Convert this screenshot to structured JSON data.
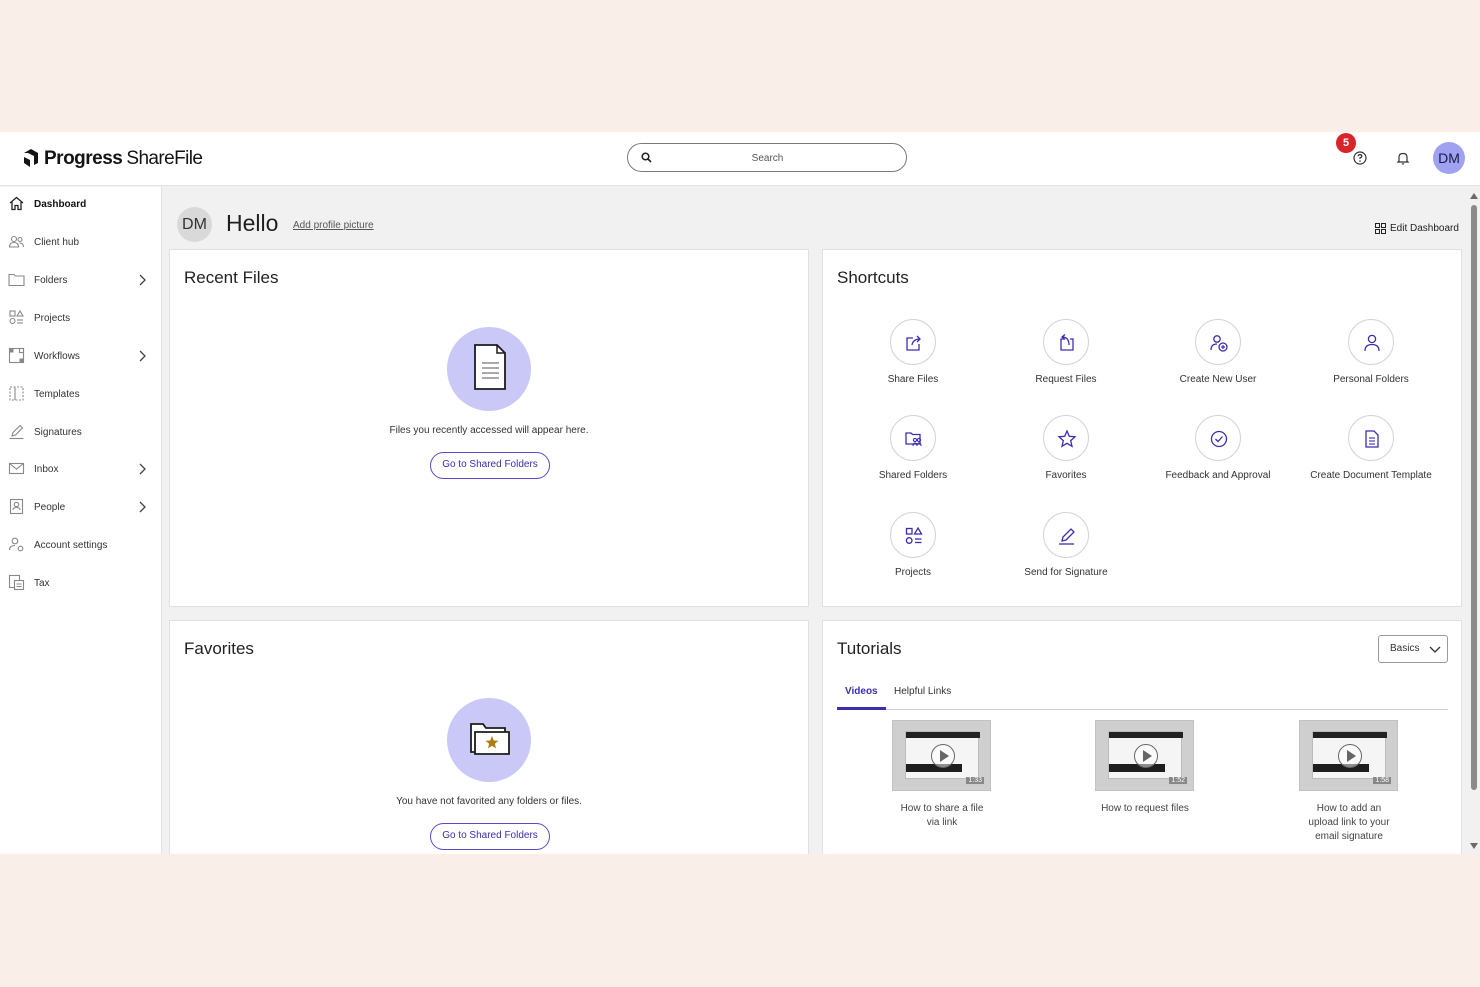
{
  "header": {
    "brand_main": "Progress",
    "brand_product": "ShareFile",
    "search_placeholder": "Search",
    "notification_count": "5",
    "user_initials": "DM"
  },
  "sidebar": {
    "items": [
      {
        "label": "Dashboard",
        "icon": "home-icon",
        "active": true
      },
      {
        "label": "Client hub",
        "icon": "people-icon"
      },
      {
        "label": "Folders",
        "icon": "folder-icon",
        "expandable": true
      },
      {
        "label": "Projects",
        "icon": "projects-icon"
      },
      {
        "label": "Workflows",
        "icon": "workflows-icon",
        "expandable": true
      },
      {
        "label": "Templates",
        "icon": "templates-icon"
      },
      {
        "label": "Signatures",
        "icon": "pen-icon"
      },
      {
        "label": "Inbox",
        "icon": "mail-icon",
        "expandable": true
      },
      {
        "label": "People",
        "icon": "contact-card-icon",
        "expandable": true
      },
      {
        "label": "Account settings",
        "icon": "user-gear-icon"
      },
      {
        "label": "Tax",
        "icon": "tax-icon"
      }
    ]
  },
  "greeting": {
    "initials": "DM",
    "hello": "Hello",
    "add_profile_picture": "Add profile picture",
    "edit_dashboard": "Edit Dashboard"
  },
  "recent_files": {
    "title": "Recent Files",
    "empty_text": "Files you recently accessed will appear here.",
    "button": "Go to Shared Folders"
  },
  "shortcuts": {
    "title": "Shortcuts",
    "items": [
      {
        "label": "Share Files",
        "icon": "share-icon"
      },
      {
        "label": "Request Files",
        "icon": "request-icon"
      },
      {
        "label": "Create New User",
        "icon": "add-user-icon"
      },
      {
        "label": "Personal Folders",
        "icon": "person-icon"
      },
      {
        "label": "Shared Folders",
        "icon": "shared-folder-icon"
      },
      {
        "label": "Favorites",
        "icon": "star-icon"
      },
      {
        "label": "Feedback and Approval",
        "icon": "check-circle-icon"
      },
      {
        "label": "Create Document Template",
        "icon": "document-icon"
      },
      {
        "label": "Projects",
        "icon": "projects-icon"
      },
      {
        "label": "Send for Signature",
        "icon": "pen-icon"
      }
    ]
  },
  "favorites": {
    "title": "Favorites",
    "empty_text": "You have not favorited any folders or files.",
    "button": "Go to Shared Folders"
  },
  "tutorials": {
    "title": "Tutorials",
    "dropdown": "Basics",
    "tabs": [
      "Videos",
      "Helpful Links"
    ],
    "videos": [
      {
        "title": "How to share a file via link",
        "duration": "1:33"
      },
      {
        "title": "How to request files",
        "duration": "1:52"
      },
      {
        "title": "How to add an upload link to your email signature",
        "duration": "1:58"
      }
    ]
  },
  "colors": {
    "accent": "#3b2fb0",
    "avatar": "#9fa2f0",
    "illustration": "#c9c8f6",
    "badge": "#d9252a"
  }
}
